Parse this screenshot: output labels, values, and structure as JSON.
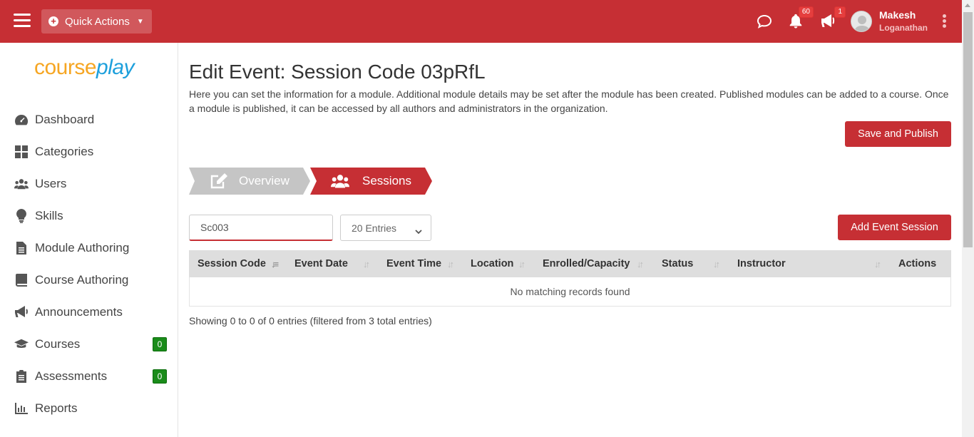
{
  "topbar": {
    "quick_actions_label": "Quick Actions",
    "notifications_count": "60",
    "announcements_count": "1",
    "user_first": "Makesh",
    "user_last": "Loganathan",
    "brand_color": "#c62f34"
  },
  "sidebar": {
    "logo_part1": "course",
    "logo_part2": "play",
    "items": [
      {
        "label": "Dashboard",
        "icon": "tachometer-icon"
      },
      {
        "label": "Categories",
        "icon": "grid-icon"
      },
      {
        "label": "Users",
        "icon": "users-icon"
      },
      {
        "label": "Skills",
        "icon": "lightbulb-icon"
      },
      {
        "label": "Module Authoring",
        "icon": "file-icon"
      },
      {
        "label": "Course Authoring",
        "icon": "book-icon"
      },
      {
        "label": "Announcements",
        "icon": "megaphone-icon"
      },
      {
        "label": "Courses",
        "icon": "graduation-cap-icon",
        "badge": "0"
      },
      {
        "label": "Assessments",
        "icon": "clipboard-icon",
        "badge": "0"
      },
      {
        "label": "Reports",
        "icon": "bar-chart-icon"
      }
    ]
  },
  "main": {
    "title": "Edit Event: Session Code 03pRfL",
    "description": "Here you can set the information for a module. Additional module details may be set after the module has been created. Published modules can be added to a course. Once a module is published, it can be accessed by all authors and administrators in the organization.",
    "save_publish_label": "Save and Publish",
    "steps": [
      {
        "label": "Overview",
        "icon": "edit-icon",
        "active": false
      },
      {
        "label": "Sessions",
        "icon": "users-icon",
        "active": true
      }
    ],
    "search_value": "Sc003",
    "entries_value": "20 Entries",
    "add_session_label": "Add Event Session",
    "table": {
      "columns": [
        "Session Code",
        "Event Date",
        "Event Time",
        "Location",
        "Enrolled/Capacity",
        "Status",
        "Instructor",
        "Actions"
      ],
      "empty_message": "No matching records found"
    },
    "showing_text": "Showing 0 to 0 of 0 entries (filtered from 3 total entries)"
  }
}
